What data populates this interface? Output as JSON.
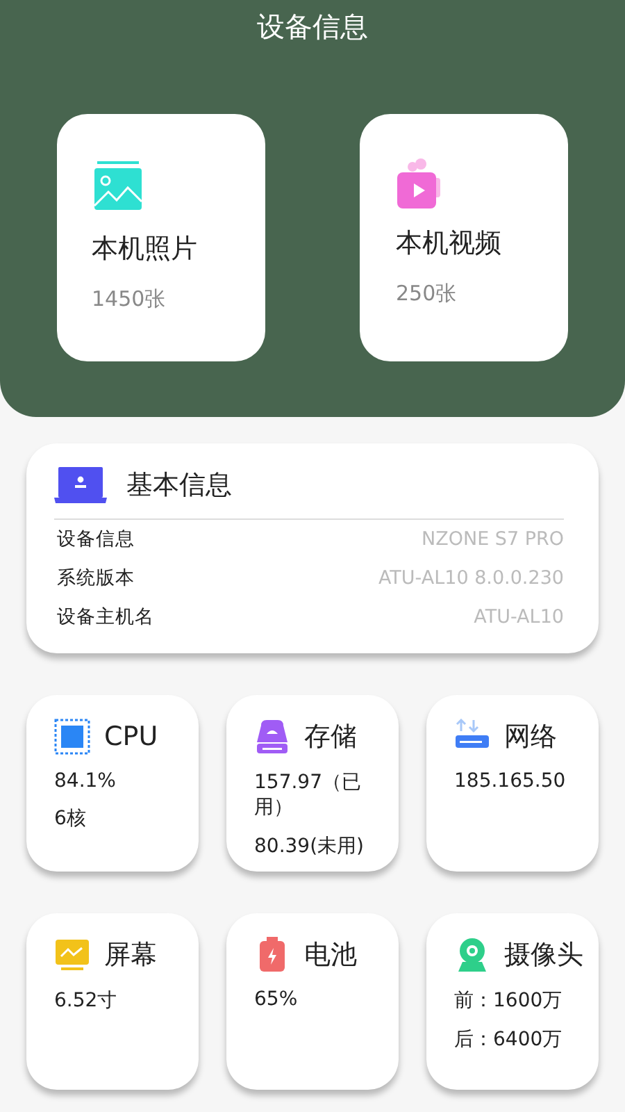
{
  "header": {
    "title": "设备信息"
  },
  "media": [
    {
      "kind": "photo",
      "label": "本机照片",
      "count": "1450张"
    },
    {
      "kind": "video",
      "label": "本机视频",
      "count": "250张"
    }
  ],
  "basic_info": {
    "title": "基本信息",
    "rows": [
      {
        "label": "设备信息",
        "value": "NZONE S7 PRO"
      },
      {
        "label": "系统版本",
        "value": "ATU-AL10 8.0.0.230"
      },
      {
        "label": "设备主机名",
        "value": "ATU-AL10"
      }
    ]
  },
  "tiles": [
    {
      "kind": "cpu",
      "title": "CPU",
      "lines": [
        "84.1%",
        "6核"
      ]
    },
    {
      "kind": "storage",
      "title": "存储",
      "lines": [
        "157.97（已用）",
        "80.39(未用)"
      ]
    },
    {
      "kind": "network",
      "title": "网络",
      "lines": [
        "185.165.50"
      ]
    },
    {
      "kind": "screen",
      "title": "屏幕",
      "lines": [
        "6.52寸"
      ]
    },
    {
      "kind": "battery",
      "title": "电池",
      "lines": [
        "65%"
      ]
    },
    {
      "kind": "camera",
      "title": "摄像头",
      "lines": [
        "前：1600万",
        "后：6400万"
      ]
    }
  ]
}
